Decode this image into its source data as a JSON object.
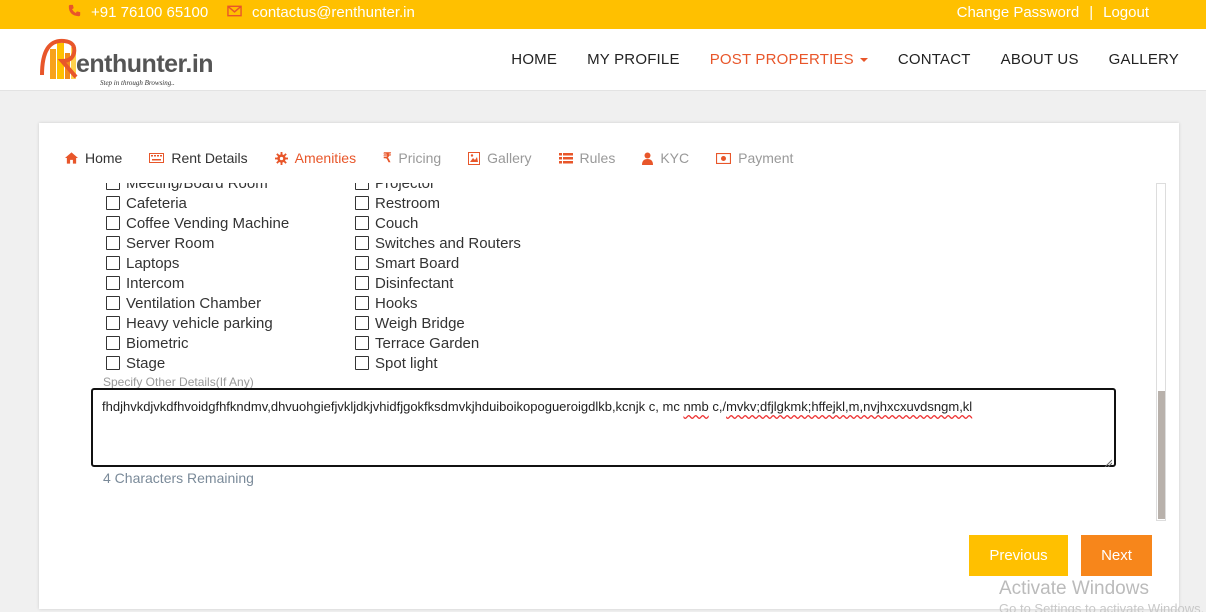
{
  "topbar": {
    "phone": "+91 76100 65100",
    "email": "contactus@renthunter.in",
    "change_password": "Change Password",
    "separator": "|",
    "logout": "Logout",
    "icon_color": "#e8562a",
    "bg_color": "#ffc000"
  },
  "logo": {
    "name": "enthunter.in",
    "tagline": "Step in through Browsing.."
  },
  "nav": {
    "home": "HOME",
    "profile": "MY PROFILE",
    "post": "POST PROPERTIES",
    "contact": "CONTACT",
    "about": "ABOUT US",
    "gallery": "GALLERY",
    "active_color": "#e8562a"
  },
  "tabs": [
    {
      "label": "Home",
      "icon": "home-icon"
    },
    {
      "label": "Rent Details",
      "icon": "keyboard-icon"
    },
    {
      "label": "Amenities",
      "icon": "gear-icon"
    },
    {
      "label": "Pricing",
      "icon": "rupee-icon"
    },
    {
      "label": "Gallery",
      "icon": "image-icon"
    },
    {
      "label": "Rules",
      "icon": "list-icon"
    },
    {
      "label": "KYC",
      "icon": "user-icon"
    },
    {
      "label": "Payment",
      "icon": "money-icon"
    }
  ],
  "amenities": {
    "col1": [
      "Meeting/Board Room",
      "Cafeteria",
      "Coffee Vending Machine",
      "Server Room",
      "Laptops",
      "Intercom",
      "Ventilation Chamber",
      "Heavy vehicle parking",
      "Biometric",
      "Stage"
    ],
    "col2": [
      "Projector",
      "Restroom",
      "Couch",
      "Switches and Routers",
      "Smart Board",
      "Disinfectant",
      "Hooks",
      "Weigh Bridge",
      "Terrace Garden",
      "Spot light"
    ]
  },
  "other_details": {
    "label": "Specify Other Details(If Any)",
    "value_a": "fhdjhvkdjvkdfhvoidgfhfkndmv,dhvuohgiefjvkljdkjvhidfjgokfksdmvkjhduiboikopogueroigdlkb,kcnjk c, mc ",
    "value_b": "nmb",
    "value_c": " c,/",
    "value_d": "mvkv;dfjlgkmk;hffejkl,m,nvjhxcxuvdsngm,kl",
    "remaining": "4 Characters Remaining"
  },
  "buttons": {
    "previous": "Previous",
    "next": "Next"
  },
  "watermark": {
    "title": "Activate Windows",
    "subtitle": "Go to Settings to activate Windows."
  }
}
